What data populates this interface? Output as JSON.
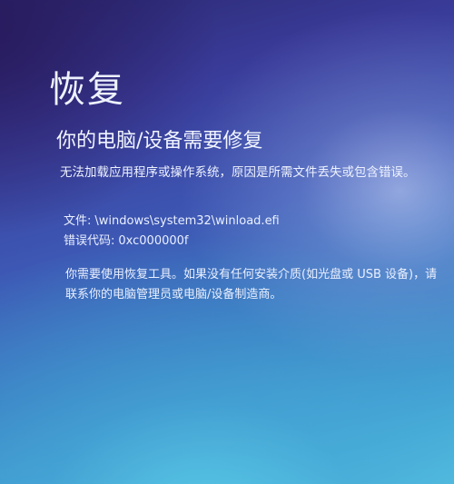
{
  "screen": {
    "title": "恢复",
    "subtitle": "你的电脑/设备需要修复",
    "description": "无法加载应用程序或操作系统，原因是所需文件丢失或包含错误。",
    "file": {
      "label": "文件:",
      "value": "\\windows\\system32\\winload.efi"
    },
    "error_code": {
      "label": "错误代码:",
      "value": "0xc000000f"
    },
    "instruction": "你需要使用恢复工具。如果没有任何安装介质(如光盘或 USB 设备)，请联系你的电脑管理员或电脑/设备制造商。"
  },
  "colors": {
    "background_top": "#2a2770",
    "background_mid": "#3d58b4",
    "background_bottom": "#55bfe0",
    "text": "#f2f6ff"
  }
}
